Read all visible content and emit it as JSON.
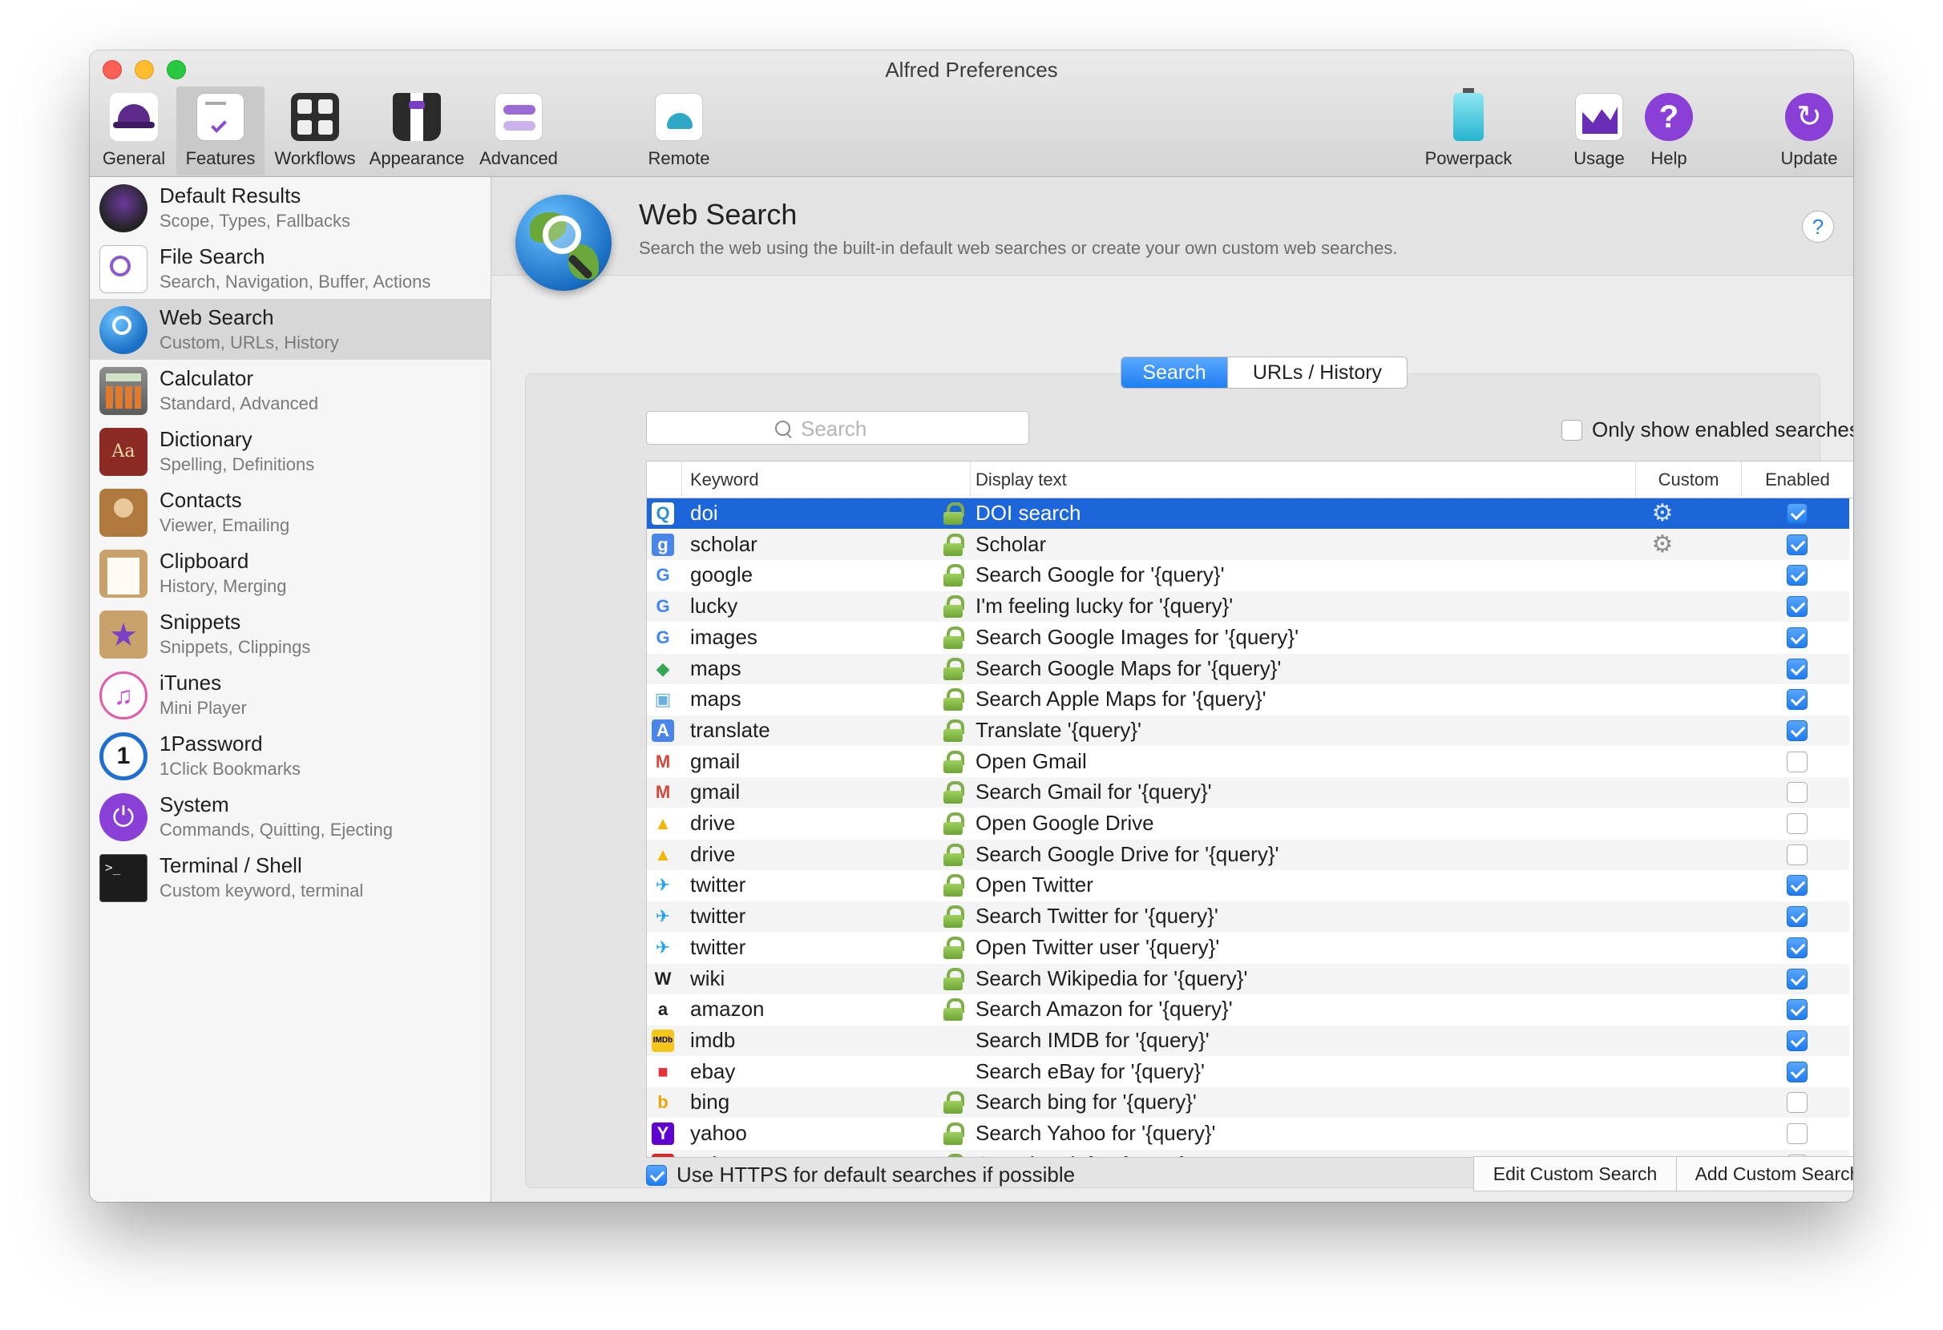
{
  "window": {
    "title": "Alfred Preferences"
  },
  "toolbar": {
    "items": [
      {
        "label": "General",
        "icon": "hat-icon"
      },
      {
        "label": "Features",
        "icon": "checklist-icon"
      },
      {
        "label": "Workflows",
        "icon": "workflows-icon"
      },
      {
        "label": "Appearance",
        "icon": "tuxedo-icon"
      },
      {
        "label": "Advanced",
        "icon": "toggles-icon"
      },
      {
        "label": "Remote",
        "icon": "remote-icon"
      },
      {
        "label": "Powerpack",
        "icon": "battery-icon"
      },
      {
        "label": "Usage",
        "icon": "usage-chart-icon"
      },
      {
        "label": "Help",
        "icon": "help-icon"
      },
      {
        "label": "Update",
        "icon": "update-icon"
      }
    ],
    "active": "Features"
  },
  "sidebar": {
    "items": [
      {
        "title": "Default Results",
        "subtitle": "Scope, Types, Fallbacks"
      },
      {
        "title": "File Search",
        "subtitle": "Search, Navigation, Buffer, Actions"
      },
      {
        "title": "Web Search",
        "subtitle": "Custom, URLs, History"
      },
      {
        "title": "Calculator",
        "subtitle": "Standard, Advanced"
      },
      {
        "title": "Dictionary",
        "subtitle": "Spelling, Definitions"
      },
      {
        "title": "Contacts",
        "subtitle": "Viewer, Emailing"
      },
      {
        "title": "Clipboard",
        "subtitle": "History, Merging"
      },
      {
        "title": "Snippets",
        "subtitle": "Snippets, Clippings"
      },
      {
        "title": "iTunes",
        "subtitle": "Mini Player"
      },
      {
        "title": "1Password",
        "subtitle": "1Click Bookmarks"
      },
      {
        "title": "System",
        "subtitle": "Commands, Quitting, Ejecting"
      },
      {
        "title": "Terminal / Shell",
        "subtitle": "Custom keyword, terminal"
      }
    ],
    "selected": "Web Search"
  },
  "header": {
    "title": "Web Search",
    "description": "Search the web using the built-in default web searches or create your own custom web searches.",
    "help_label": "?"
  },
  "tabs": {
    "search": "Search",
    "urls": "URLs / History",
    "active": "Search"
  },
  "search": {
    "placeholder": "Search",
    "value": ""
  },
  "filter": {
    "label": "Only show enabled searches",
    "checked": false
  },
  "table": {
    "columns": {
      "keyword": "Keyword",
      "display": "Display text",
      "custom": "Custom",
      "enabled": "Enabled"
    },
    "rows": [
      {
        "keyword": "doi",
        "display": "DOI search",
        "locked": true,
        "custom": true,
        "enabled": true,
        "icon": "doi-icon",
        "selected": true
      },
      {
        "keyword": "scholar",
        "display": "Scholar",
        "locked": true,
        "custom": true,
        "enabled": true,
        "icon": "scholar-icon"
      },
      {
        "keyword": "google",
        "display": "Search Google for '{query}'",
        "locked": true,
        "custom": false,
        "enabled": true,
        "icon": "google-icon"
      },
      {
        "keyword": "lucky",
        "display": "I'm feeling lucky for '{query}'",
        "locked": true,
        "custom": false,
        "enabled": true,
        "icon": "google-icon"
      },
      {
        "keyword": "images",
        "display": "Search Google Images for '{query}'",
        "locked": true,
        "custom": false,
        "enabled": true,
        "icon": "google-icon"
      },
      {
        "keyword": "maps",
        "display": "Search Google Maps for '{query}'",
        "locked": true,
        "custom": false,
        "enabled": true,
        "icon": "google-maps-icon"
      },
      {
        "keyword": "maps",
        "display": "Search Apple Maps for '{query}'",
        "locked": true,
        "custom": false,
        "enabled": true,
        "icon": "apple-maps-icon"
      },
      {
        "keyword": "translate",
        "display": "Translate '{query}'",
        "locked": true,
        "custom": false,
        "enabled": true,
        "icon": "translate-icon"
      },
      {
        "keyword": "gmail",
        "display": "Open Gmail",
        "locked": true,
        "custom": false,
        "enabled": false,
        "icon": "gmail-icon"
      },
      {
        "keyword": "gmail",
        "display": "Search Gmail for '{query}'",
        "locked": true,
        "custom": false,
        "enabled": false,
        "icon": "gmail-icon"
      },
      {
        "keyword": "drive",
        "display": "Open Google Drive",
        "locked": true,
        "custom": false,
        "enabled": false,
        "icon": "drive-icon"
      },
      {
        "keyword": "drive",
        "display": "Search Google Drive for '{query}'",
        "locked": true,
        "custom": false,
        "enabled": false,
        "icon": "drive-icon"
      },
      {
        "keyword": "twitter",
        "display": "Open Twitter",
        "locked": true,
        "custom": false,
        "enabled": true,
        "icon": "twitter-icon"
      },
      {
        "keyword": "twitter",
        "display": "Search Twitter for '{query}'",
        "locked": true,
        "custom": false,
        "enabled": true,
        "icon": "twitter-icon"
      },
      {
        "keyword": "twitter",
        "display": "Open Twitter user '{query}'",
        "locked": true,
        "custom": false,
        "enabled": true,
        "icon": "twitter-icon"
      },
      {
        "keyword": "wiki",
        "display": "Search Wikipedia for '{query}'",
        "locked": true,
        "custom": false,
        "enabled": true,
        "icon": "wikipedia-icon"
      },
      {
        "keyword": "amazon",
        "display": "Search Amazon for '{query}'",
        "locked": true,
        "custom": false,
        "enabled": true,
        "icon": "amazon-icon"
      },
      {
        "keyword": "imdb",
        "display": "Search IMDB for '{query}'",
        "locked": false,
        "custom": false,
        "enabled": true,
        "icon": "imdb-icon"
      },
      {
        "keyword": "ebay",
        "display": "Search eBay for '{query}'",
        "locked": false,
        "custom": false,
        "enabled": true,
        "icon": "ebay-icon"
      },
      {
        "keyword": "bing",
        "display": "Search bing for '{query}'",
        "locked": true,
        "custom": false,
        "enabled": false,
        "icon": "bing-icon"
      },
      {
        "keyword": "yahoo",
        "display": "Search Yahoo for '{query}'",
        "locked": true,
        "custom": false,
        "enabled": false,
        "icon": "yahoo-icon"
      },
      {
        "keyword": "ask",
        "display": "Search Ask for '{query}'",
        "locked": true,
        "custom": false,
        "enabled": false,
        "icon": "ask-icon"
      }
    ]
  },
  "footer": {
    "https_label": "Use HTTPS for default searches if possible",
    "https_checked": true,
    "edit_button": "Edit Custom Search",
    "add_button": "Add Custom Search"
  },
  "colors": {
    "accent": "#1d66d9",
    "lock_green": "#7fae4a",
    "selection_sidebar": "#d7d7d7"
  }
}
